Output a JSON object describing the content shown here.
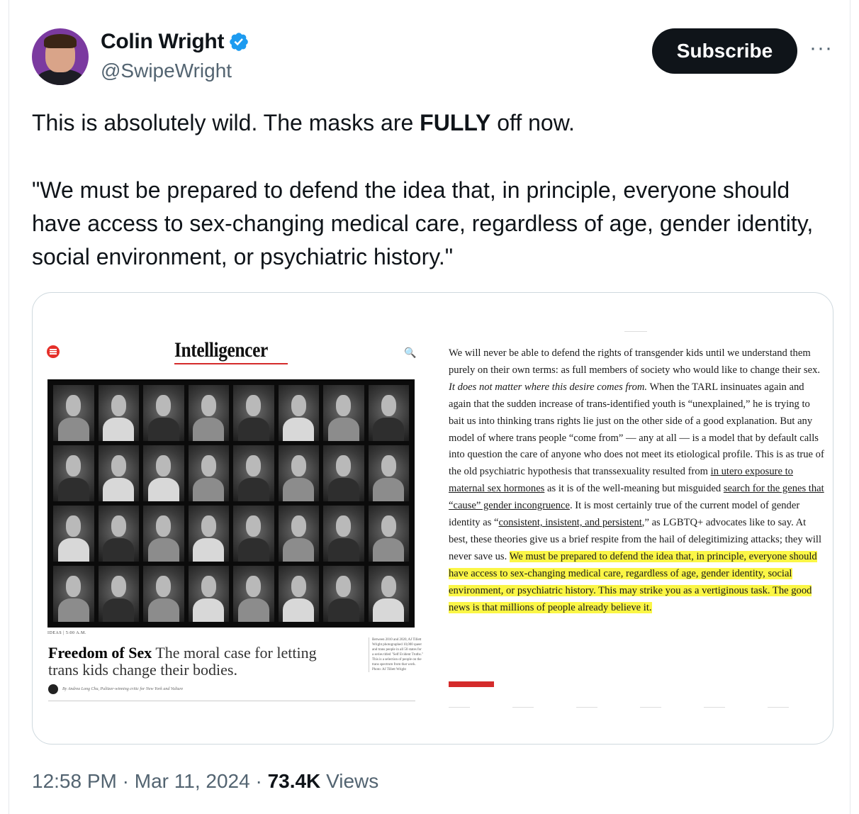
{
  "author": {
    "name": "Colin Wright",
    "handle": "@SwipeWright",
    "verified": true,
    "verified_icon": "verified-badge-icon",
    "verified_color": "#1d9bf0"
  },
  "actions": {
    "subscribe_label": "Subscribe",
    "more_icon": "more-horizontal-icon",
    "more_label": "···"
  },
  "tweet": {
    "line1_before": "This is absolutely wild. The masks are ",
    "line1_bold": "FULLY",
    "line1_after": " off now.",
    "quote": "\"We must be prepared to defend the idea that, in principle, everyone should have access to sex-changing medical care, regardless of age, gender identity, social environment, or psychiatric history.\""
  },
  "media": {
    "magazine_title": "Intelligencer",
    "section": "IDEAS  |  5:00 A.M.",
    "headline_bold": "Freedom of Sex",
    "headline_rest": " The moral case for letting trans kids change their bodies.",
    "byline": "By Andrea Long Chu, Pulitzer-winning critic for New York and Vulture",
    "caption": "Between 2010 and 2020, AJ Tillett Wright photographed 10,000 queer and trans people in all 50 states for a series titled \"Self Evident Truths.\" This is a selection of people on the trans spectrum from that work. Photo: AJ Tillett Wright",
    "excerpt": {
      "p1": "We will never be able to defend the rights of transgender kids until we understand them purely on their own terms: as full members of society who would like to change their sex. ",
      "p1_italic": "It does not matter where this desire comes from.",
      "p2": " When the TARL insinuates again and again that the sudden increase of trans-identified youth is “unexplained,” he is trying to bait us into thinking trans rights lie just on the other side of a good explanation. But any model of where trans people “come from” — any at all — is a model that by default calls into question the care of anyone who does not meet its etiological profile. This is as true of the old psychiatric hypothesis that transsexuality resulted from ",
      "link1": "in utero exposure to maternal sex hormones",
      "p3": " as it is of the well-meaning but misguided ",
      "link2": "search for the genes that “cause” gender incongruence",
      "p4": ". It is most certainly true of the current model of gender identity as “",
      "link3": "consistent, insistent, and persistent",
      "p5": ",” as LGBTQ+ advocates like to say. At best, these theories give us a brief respite from the hail of delegitimizing attacks; they will never save us. ",
      "highlight": "We must be prepared to defend the idea that, in principle, everyone should have access to sex-changing medical care, regardless of age, gender identity, social environment, or psychiatric history. This may strike you as a vertiginous task. The good news is that millions of people already believe it."
    }
  },
  "meta": {
    "time": "12:58 PM",
    "date": "Mar 11, 2024",
    "views_count": "73.4K",
    "views_label": "Views"
  }
}
